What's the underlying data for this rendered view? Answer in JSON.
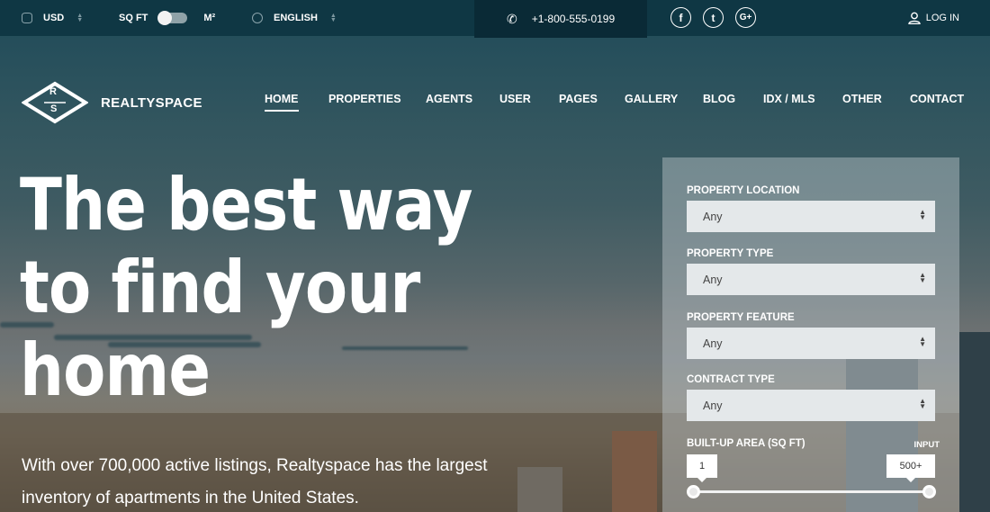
{
  "topbar": {
    "currency": {
      "icon": "coins-icon",
      "label": "USD"
    },
    "unit_toggle": {
      "left_label": "SQ FT",
      "right_label": "M²",
      "selected": "SQ FT"
    },
    "language": {
      "icon": "globe-icon",
      "label": "ENGLISH"
    },
    "phone": {
      "icon": "phone-icon",
      "number": "+1-800-555-0199"
    },
    "social": [
      {
        "name": "facebook",
        "glyph": "f"
      },
      {
        "name": "twitter",
        "glyph": "t"
      },
      {
        "name": "google-plus",
        "glyph": "G+"
      }
    ],
    "login": {
      "icon": "user-icon",
      "label": "LOG IN"
    }
  },
  "header": {
    "logo": {
      "top_letter": "R",
      "bottom_letter": "S",
      "name": "REALTYSPACE"
    },
    "nav": [
      {
        "label": "HOME",
        "active": true
      },
      {
        "label": "PROPERTIES",
        "active": false
      },
      {
        "label": "AGENTS",
        "active": false
      },
      {
        "label": "USER",
        "active": false
      },
      {
        "label": "PAGES",
        "active": false
      },
      {
        "label": "GALLERY",
        "active": false
      },
      {
        "label": "BLOG",
        "active": false
      },
      {
        "label": "IDX / MLS",
        "active": false
      },
      {
        "label": "OTHER",
        "active": false
      },
      {
        "label": "CONTACT",
        "active": false
      }
    ]
  },
  "hero": {
    "headline_lines": [
      "The best way",
      "to find your",
      "home"
    ],
    "subtext_lines": [
      "With over 700,000 active listings, Realtyspace has the largest",
      "inventory of apartments in the United States."
    ]
  },
  "search": {
    "fields": [
      {
        "label": "PROPERTY LOCATION",
        "value": "Any"
      },
      {
        "label": "PROPERTY TYPE",
        "value": "Any"
      },
      {
        "label": "PROPERTY FEATURE",
        "value": "Any"
      },
      {
        "label": "CONTRACT TYPE",
        "value": "Any"
      }
    ],
    "area": {
      "label": "BUILT-UP AREA (SQ FT)",
      "input_label": "INPUT",
      "min_value": "1",
      "max_value": "500+"
    }
  }
}
